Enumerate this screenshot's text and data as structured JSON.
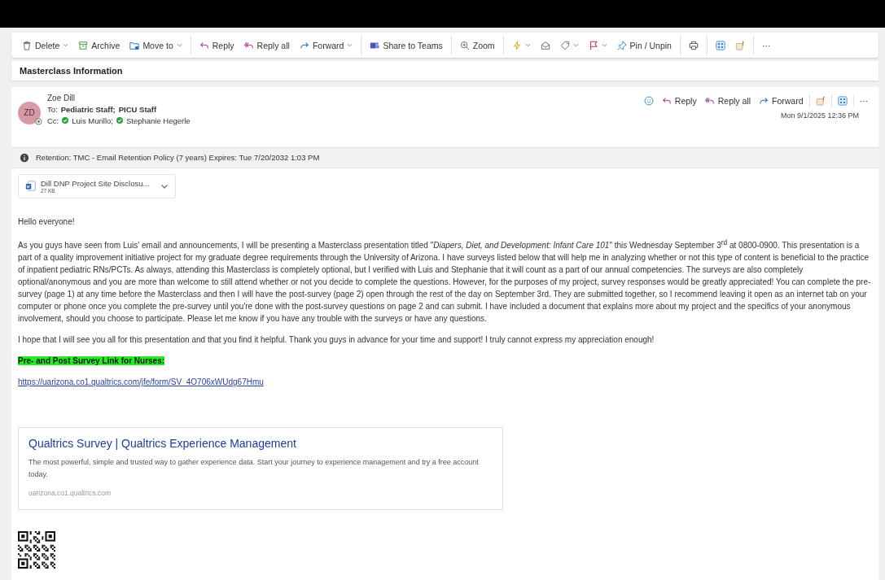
{
  "toolbar": {
    "groups": [
      [
        {
          "label": "Delete",
          "dropdown": true
        },
        {
          "label": "Archive",
          "dropdown": false
        },
        {
          "label": "Move to",
          "dropdown": true
        }
      ],
      [
        {
          "label": "Reply",
          "dropdown": false
        },
        {
          "label": "Reply all",
          "dropdown": false
        },
        {
          "label": "Forward",
          "dropdown": true
        }
      ],
      [
        {
          "label": "Share to Teams",
          "dropdown": false
        }
      ],
      [
        {
          "label": "Zoom",
          "dropdown": false
        }
      ],
      [
        {
          "dropdown": true
        },
        {
          "dropdown": false
        },
        {
          "dropdown": true
        },
        {
          "dropdown": true
        },
        {
          "label": "Pin / Unpin",
          "dropdown": false
        }
      ],
      [
        {
          "dropdown": false
        }
      ],
      [
        {
          "dropdown": false
        },
        {
          "dropdown": false
        }
      ],
      [
        {
          "label": "···",
          "dropdown": false
        }
      ]
    ]
  },
  "subject": "Masterclass Information",
  "message": {
    "avatar_initials": "ZD",
    "sender": "Zoe Dill",
    "to_label": "To:",
    "to": [
      "Pediatric Staff;",
      "PICU Staff"
    ],
    "cc_label": "Cc:",
    "cc": [
      {
        "name": "Luis Murillo;",
        "color": "#2ea043"
      },
      {
        "name": "Stephanie Hegerle",
        "color": "#2ea043"
      }
    ],
    "actions": [
      "Reply",
      "Reply all",
      "Forward",
      "···"
    ],
    "date": "Mon 9/1/2025 12:36 PM",
    "retention": "Retention: TMC - Email Retention Policy (7 years) Expires: Tue 7/20/2032 1:03 PM",
    "attachment": {
      "name": "Dill DNP Project Site Disclosu...",
      "size": "27 KB"
    },
    "body": [
      {
        "kind": "text",
        "text": "Hello everyone!"
      },
      {
        "kind": "text",
        "text": "As you guys have seen from Luis' email and announcements, I will be presenting a Masterclass presentation titled \"*Diapers, Diet, and Development: Infant Care 101*\" this Wednesday September 3$^{rd}$ at 0800-0900. This presentation is a part of a quality improvement initiative project for my graduate degree requirements through the University of Arizona. I have surveys listed below that will help me in analyzing whether or not this type of content is beneficial to the practice of inpatient pediatric RNs/PCTs. As always, attending this Masterclass is completely optional, but I verified with Luis and Stephanie that it will count as a part of our annual competencies. The surveys are also completely optional/anonymous and you are more than welcome to still attend whether or not you decide to complete the questions. However, for the purposes of my project, survey responses would be greatly appreciated! You can complete the pre-survey (page 1) at any time before the Masterclass and then I will have the post-survey (page 2) open through the rest of the day on September 3rd. They are submitted together, so I recommend leaving it open as an internet tab on your computer or phone once you complete the pre-survey until you're done with the post-survey questions on page 2 and can submit. I have included a document that explains more about my project and the specifics of your anonymous involvement, should you choose to participate. Please let me know if you have any trouble with the surveys or have any questions."
      },
      {
        "kind": "text",
        "text": "I hope that I will see you all for this presentation and that you find it helpful. Thank you guys in advance for your time and support! I truly cannot express my appreciation enough!"
      },
      {
        "kind": "highlight",
        "text": "Pre- and Post Survey Link for Nurses:"
      },
      {
        "kind": "link",
        "text": "https://uarizona.co1.qualtrics.com/jfe/form/SV_4O706xWUdg67Hmu"
      },
      {
        "kind": "preview",
        "title": "Qualtrics Survey | Qualtrics Experience Management",
        "description": "The most powerful, simple and trusted way to gather experience data. Start your journey to experience management and try a free account today.",
        "domain": "uarizona.co1.qualtrics.com"
      },
      {
        "kind": "qr"
      }
    ]
  }
}
